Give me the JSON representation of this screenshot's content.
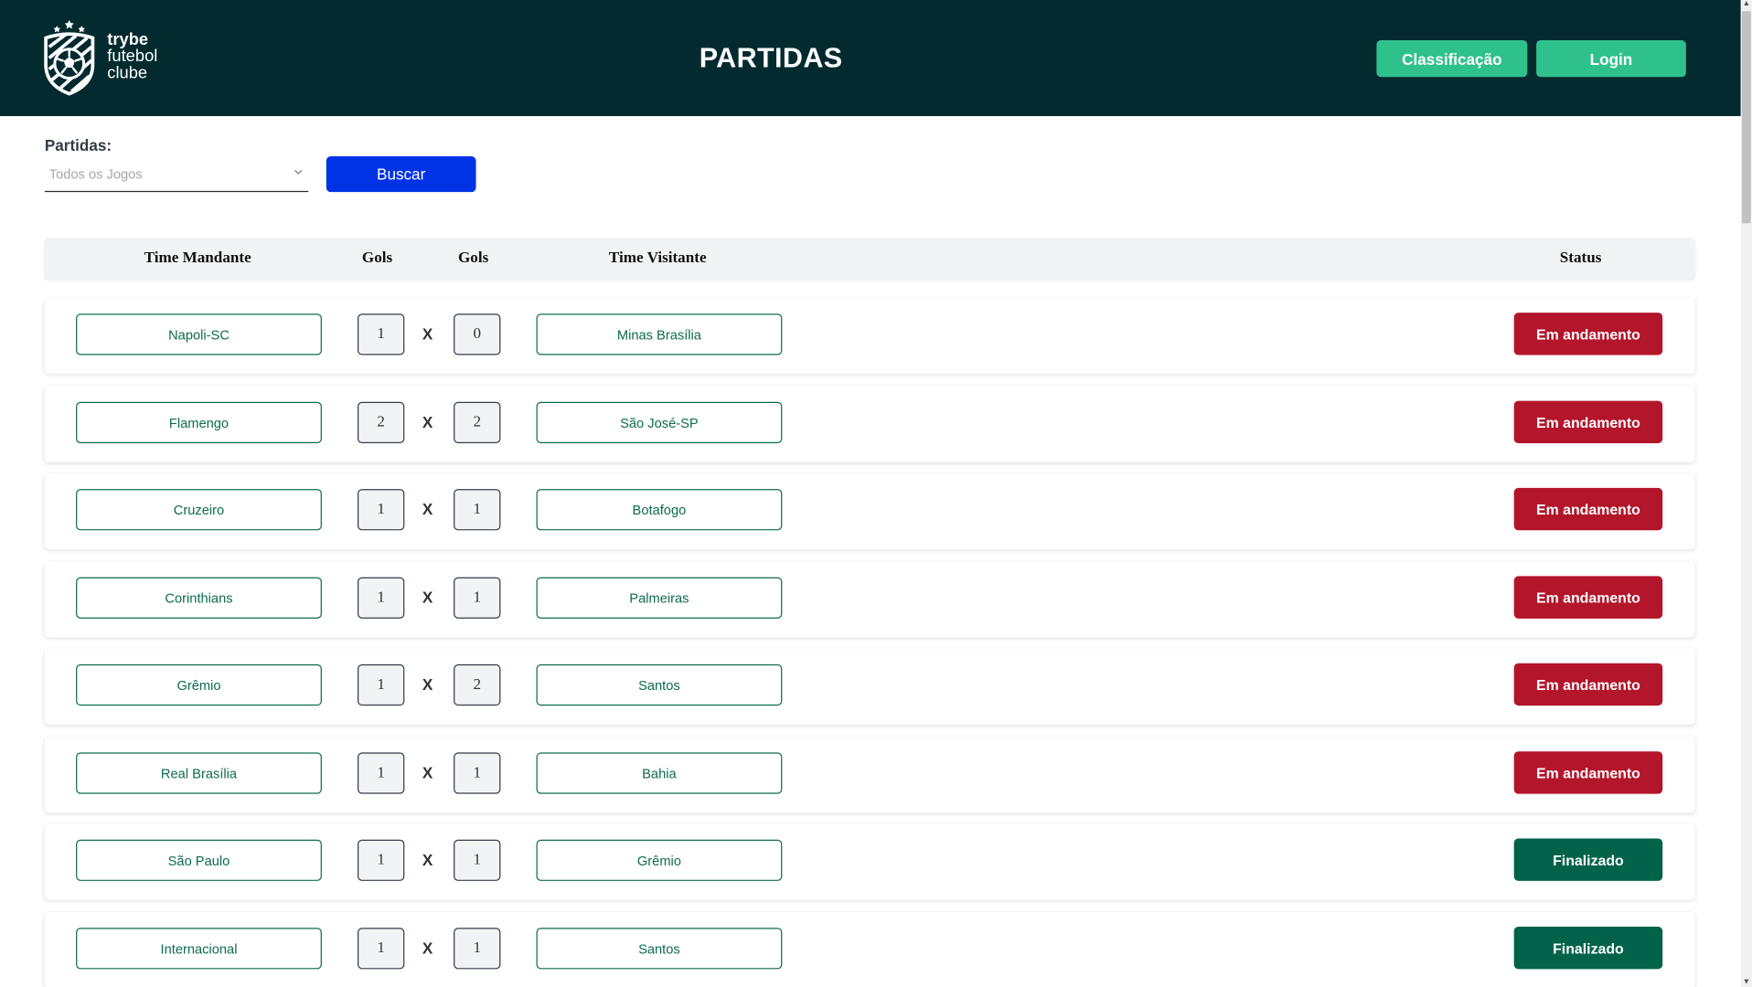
{
  "header": {
    "logo_line1": "trybe",
    "logo_line2": "futebol",
    "logo_line3": "clube",
    "title": "PARTIDAS",
    "classificacao_label": "Classificação",
    "login_label": "Login"
  },
  "filter": {
    "label": "Partidas:",
    "selected": "Todos os Jogos",
    "search_label": "Buscar"
  },
  "table": {
    "columns": [
      "Time Mandante",
      "Gols",
      "Gols",
      "Time Visitante",
      "Status"
    ],
    "separator": "X",
    "rows": [
      {
        "home": "Napoli-SC",
        "home_goals": "1",
        "away_goals": "0",
        "away": "Minas Brasília",
        "status": "Em andamento"
      },
      {
        "home": "Flamengo",
        "home_goals": "2",
        "away_goals": "2",
        "away": "São José-SP",
        "status": "Em andamento"
      },
      {
        "home": "Cruzeiro",
        "home_goals": "1",
        "away_goals": "1",
        "away": "Botafogo",
        "status": "Em andamento"
      },
      {
        "home": "Corinthians",
        "home_goals": "1",
        "away_goals": "1",
        "away": "Palmeiras",
        "status": "Em andamento"
      },
      {
        "home": "Grêmio",
        "home_goals": "1",
        "away_goals": "2",
        "away": "Santos",
        "status": "Em andamento"
      },
      {
        "home": "Real Brasília",
        "home_goals": "1",
        "away_goals": "1",
        "away": "Bahia",
        "status": "Em andamento"
      },
      {
        "home": "São Paulo",
        "home_goals": "1",
        "away_goals": "1",
        "away": "Grêmio",
        "status": "Finalizado"
      },
      {
        "home": "Internacional",
        "home_goals": "1",
        "away_goals": "1",
        "away": "Santos",
        "status": "Finalizado"
      }
    ]
  },
  "colors": {
    "header_bg": "#032a2e",
    "accent_green": "#2fc18c",
    "search_blue": "#0033e6",
    "status_in_progress": "#b3152b",
    "status_finished": "#02634a"
  },
  "icons": {
    "logo": "soccer-ball-logo-icon",
    "select_arrow": "chevron-down-icon"
  }
}
